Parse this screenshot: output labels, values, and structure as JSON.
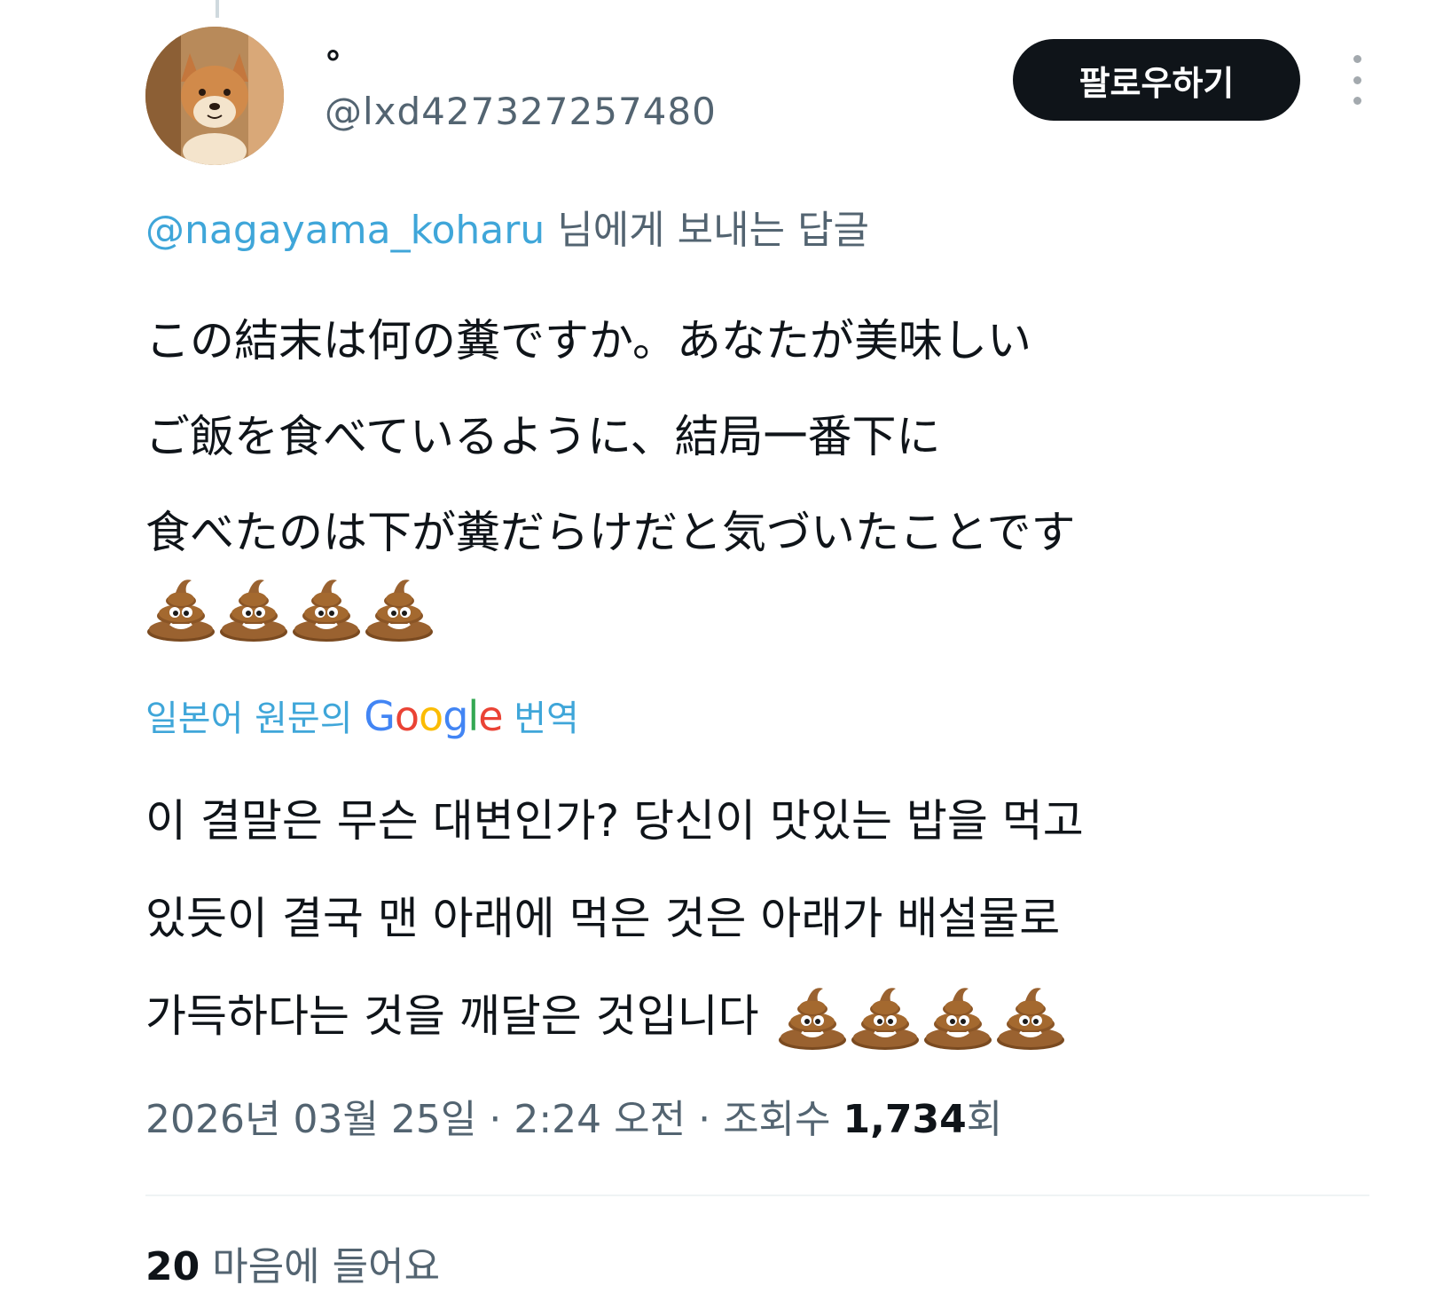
{
  "author": {
    "display_name": "°",
    "handle": "@lxd427327257480",
    "avatar_icon": "shiba-dog-avatar"
  },
  "header": {
    "follow_label": "팔로우하기",
    "more_icon": "more-vertical-icon"
  },
  "reply_to": {
    "mention": "@nagayama_koharu",
    "suffix": " 님에게 보내는 답글"
  },
  "tweet": {
    "lines": [
      "この結末は何の糞ですか。あなたが美味しい",
      "ご飯を食べているように、結局一番下に",
      "食べたのは下が糞だらけだと気づいたことです"
    ],
    "emoji_icon": "poop-emoji-icon",
    "emoji_count": 4
  },
  "translation": {
    "prefix": "일본어 원문의 ",
    "google_logo": [
      "G",
      "o",
      "o",
      "g",
      "l",
      "e"
    ],
    "suffix": " 번역",
    "lines": [
      "이 결말은 무슨 대변인가? 당신이 맛있는 밥을 먹고",
      "있듯이 결국 맨 아래에 먹은 것은 아래가 배설물로",
      "가득하다는 것을 깨달은 것입니다"
    ]
  },
  "meta": {
    "date": "2026년 03월 25일",
    "separator": " · ",
    "time": "2:24 오전",
    "views_label": "조회수 ",
    "views_count": "1,734",
    "views_suffix": "회"
  },
  "engagement": {
    "likes_count": "20",
    "likes_label": " 마음에 들어요"
  },
  "colors": {
    "link_blue": "#3fa6d9",
    "secondary_text": "#536471",
    "primary_text": "#0f1419",
    "follow_button_bg": "#0f1419"
  }
}
